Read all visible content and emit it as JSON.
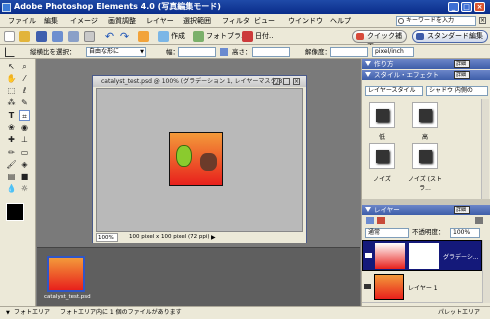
{
  "window": {
    "title": "Adobe Photoshop Elements 4.0 (写真編集モード)",
    "doc_title_suffix": "catalyst_test.psd @ 100% (グラデーション 1, レイヤーマスク/8)"
  },
  "menu": [
    "ファイル",
    "編集",
    "イメージ",
    "画質調整",
    "レイヤー",
    "選択範囲",
    "フィルタ",
    "ビュー",
    "ウインドウ",
    "ヘルプ"
  ],
  "search": {
    "value": "キーワードを入力"
  },
  "toolbar": {
    "create": "作成",
    "photo": "フォトブラ..",
    "date": "日付..",
    "quick_fix": "クイック補正",
    "standard_edit": "スタンダード編集"
  },
  "options": {
    "aspect_label": "縦横比を選択：",
    "aspect_value": "自由な形に",
    "width_label": "幅：",
    "height_label": "高さ：",
    "resolution_label": "解像度：",
    "resolution_unit": "pixel/inch"
  },
  "doc": {
    "title": "catalyst_test.psd @ 100% (グラデーション 1, レイヤーマスク/8)",
    "zoom": "100%",
    "info": "100 pixel x 100 pixel (72 ppi)"
  },
  "panels": {
    "howto": "作り方",
    "styles": "スタイル・エフェクト",
    "style_category": "レイヤースタイル",
    "style_sub": "シャドウ 内側の",
    "style_items": [
      "低",
      "高",
      "ノイズ",
      "ノイズ (ストラ..."
    ],
    "layers": "レイヤー",
    "blend_mode": "通常",
    "opacity_label": "不透明度：",
    "opacity_value": "100%",
    "layer_items": [
      "グラデーシ...",
      "レイヤー 1"
    ],
    "more_btn": "詳細",
    "menu_btn": "詳細"
  },
  "bin": {
    "file": "catalyst_test.psd"
  },
  "status": {
    "left": "フォトエリア",
    "message": "フォトエリア内に 1 個のファイルがあります",
    "right": "パレットエリア"
  },
  "colors": {
    "title_bar": "#0a2d8a",
    "panel_header": "#3e5ea9",
    "canvas_red": "#e8201c",
    "canvas_orange": "#f39a3a"
  }
}
